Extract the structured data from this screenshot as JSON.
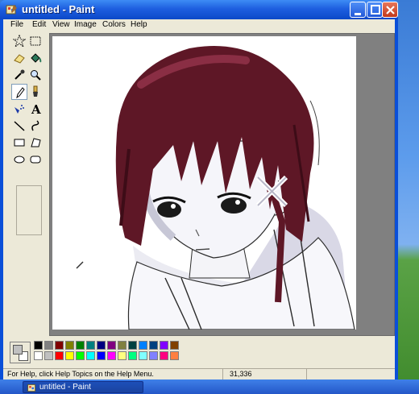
{
  "window": {
    "title": "untitled - Paint"
  },
  "menu": [
    {
      "label": "File"
    },
    {
      "label": "Edit"
    },
    {
      "label": "View"
    },
    {
      "label": "Image"
    },
    {
      "label": "Colors"
    },
    {
      "label": "Help"
    }
  ],
  "tools": [
    {
      "name": "free-form-select"
    },
    {
      "name": "select"
    },
    {
      "name": "eraser"
    },
    {
      "name": "fill-with-color"
    },
    {
      "name": "pick-color"
    },
    {
      "name": "magnifier"
    },
    {
      "name": "pencil",
      "active": true
    },
    {
      "name": "brush"
    },
    {
      "name": "airbrush"
    },
    {
      "name": "text"
    },
    {
      "name": "line"
    },
    {
      "name": "curve"
    },
    {
      "name": "rectangle"
    },
    {
      "name": "polygon"
    },
    {
      "name": "ellipse"
    },
    {
      "name": "rounded-rectangle"
    }
  ],
  "colors": {
    "foreground": "#c0c0c0",
    "background": "#ffffff",
    "palette_top": [
      "#000000",
      "#808080",
      "#800000",
      "#808000",
      "#008000",
      "#008080",
      "#000080",
      "#800080",
      "#808040",
      "#004040",
      "#0080ff",
      "#004080",
      "#8000ff",
      "#804000"
    ],
    "palette_bottom": [
      "#ffffff",
      "#c0c0c0",
      "#ff0000",
      "#ffff00",
      "#00ff00",
      "#00ffff",
      "#0000ff",
      "#ff00ff",
      "#ffff80",
      "#00ff80",
      "#80ffff",
      "#8080ff",
      "#ff0080",
      "#ff8040"
    ]
  },
  "status": {
    "help_text": "For Help, click Help Topics on the Help Menu.",
    "coordinates": "31,336"
  },
  "taskbar": {
    "button_label": "untitled - Paint"
  }
}
